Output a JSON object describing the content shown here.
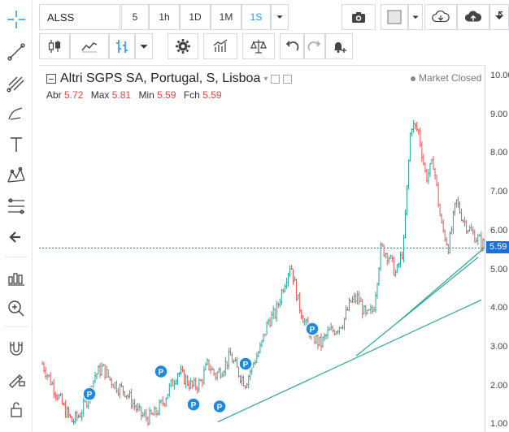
{
  "symbol": {
    "value": "ALSS"
  },
  "resolutions": [
    {
      "label": "5",
      "active": false
    },
    {
      "label": "1h",
      "active": false
    },
    {
      "label": "1D",
      "active": false
    },
    {
      "label": "1M",
      "active": false
    },
    {
      "label": "1S",
      "active": true
    }
  ],
  "left_toolbar": [
    "crosshair-icon",
    "trendline-icon",
    "pitchfork-icon",
    "brush-icon",
    "text-icon",
    "pattern-icon",
    "fib-icon",
    "back-arrow-icon",
    "measure-icon",
    "zoom-icon",
    "magnet-icon",
    "lock-drawings-icon",
    "unlock-icon"
  ],
  "legend": {
    "title": "Altri SGPS SA, Portugal, S, Lisboa",
    "market_status": "Market Closed",
    "ohlc": [
      {
        "label": "Abr",
        "value": "5.72"
      },
      {
        "label": "Max",
        "value": "5.81"
      },
      {
        "label": "Min",
        "value": "5.59"
      },
      {
        "label": "Fch",
        "value": "5.59"
      }
    ]
  },
  "price_axis": {
    "ticks": [
      "10.00",
      "9.00",
      "8.00",
      "7.00",
      "6.00",
      "5.00",
      "4.00",
      "3.00",
      "2.00",
      "1.00"
    ],
    "last_price": "5.59"
  },
  "colors": {
    "up": "#26a69a",
    "down": "#ef5350",
    "accent": "#2196f3",
    "trendline": "#26a69a",
    "marker": "#1e88e5"
  },
  "chart_data": {
    "type": "line",
    "series": [
      {
        "values": [
          2.6,
          2.2,
          1.8,
          1.4,
          1.1,
          1.3,
          1.7,
          2.3,
          2.5,
          2.2,
          2.0,
          1.9,
          1.6,
          1.3,
          1.2,
          1.3,
          1.6,
          2.0,
          2.4,
          2.2,
          2.0,
          2.1,
          2.6,
          2.3,
          2.5,
          2.8,
          2.4,
          2.1,
          2.6,
          3.0,
          3.7,
          3.9,
          4.6,
          5.2,
          4.2,
          3.6,
          3.3,
          3.1,
          3.4,
          3.5,
          3.7,
          4.2,
          4.3,
          3.8,
          4.0,
          5.6,
          5.4,
          4.9,
          5.6,
          8.8,
          8.6,
          7.4,
          7.8,
          6.2,
          5.6,
          6.8,
          6.3,
          6.0,
          5.8,
          5.6
        ]
      }
    ]
  }
}
